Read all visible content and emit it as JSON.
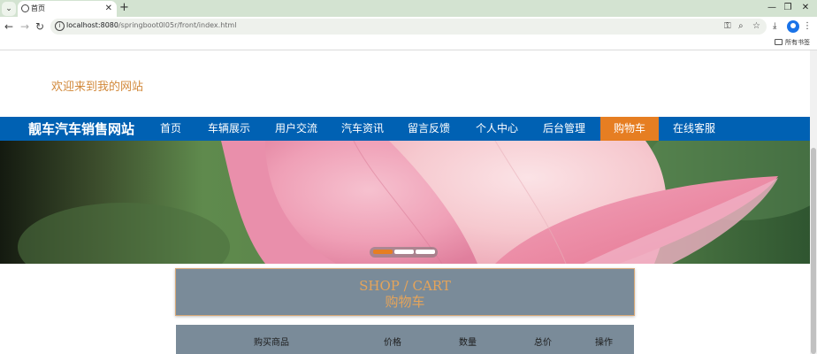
{
  "browser": {
    "tab_title": "首页",
    "url_host": "localhost:8080",
    "url_path": "/springboot0l05r/front/index.html",
    "bookmarks_label": "所有书签"
  },
  "page": {
    "welcome": "欢迎来到我的网站",
    "site_title": "靓车汽车销售网站",
    "nav": [
      {
        "label": "首页",
        "active": false
      },
      {
        "label": "车辆展示",
        "active": false
      },
      {
        "label": "用户交流",
        "active": false
      },
      {
        "label": "汽车资讯",
        "active": false
      },
      {
        "label": "留言反馈",
        "active": false
      },
      {
        "label": "个人中心",
        "active": false
      },
      {
        "label": "后台管理",
        "active": false
      },
      {
        "label": "购物车",
        "active": true
      },
      {
        "label": "在线客服",
        "active": false
      }
    ],
    "carousel": {
      "slide_count": 3,
      "active_index": 0
    },
    "section": {
      "title_en": "SHOP / CART",
      "title_cn": "购物车"
    },
    "cart_columns": [
      "购买商品",
      "价格",
      "数量",
      "总价",
      "操作"
    ]
  },
  "colors": {
    "nav_bg": "#0061b3",
    "accent": "#e67e22",
    "welcome_text": "#d2893b",
    "section_bg": "#7a8b99"
  }
}
